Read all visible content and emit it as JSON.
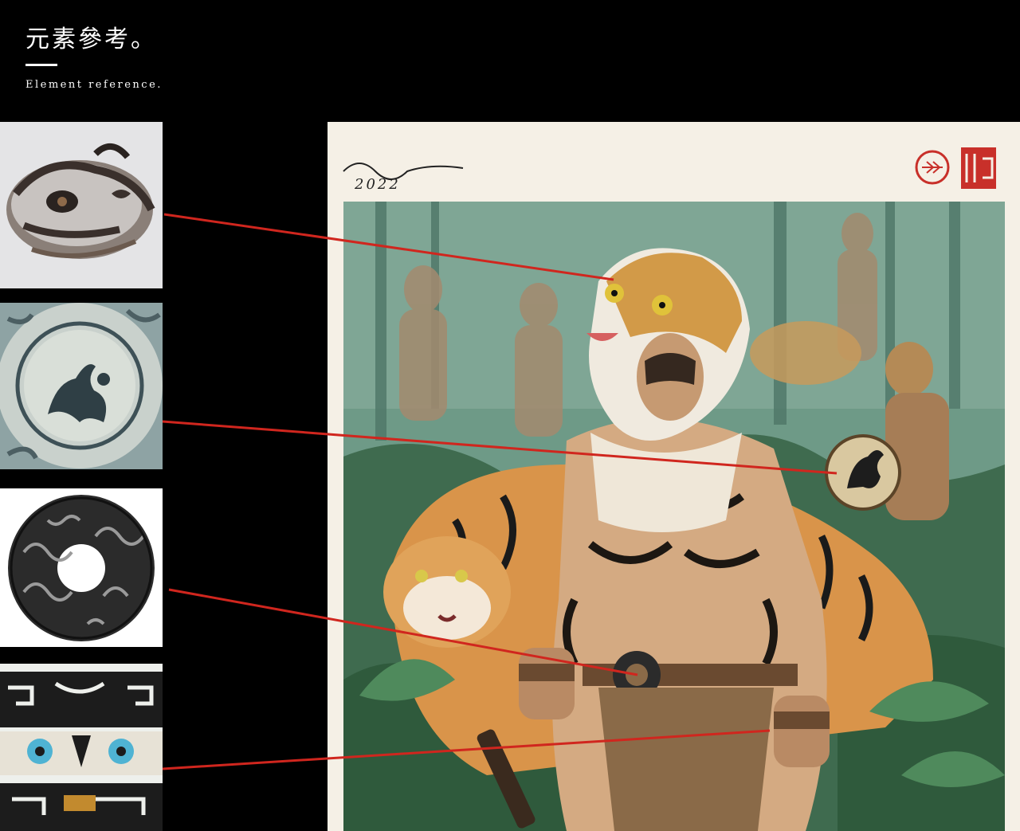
{
  "header": {
    "title_cn": "元素參考。",
    "title_en": "Element reference."
  },
  "painting": {
    "signature_year": "2022"
  },
  "references": [
    {
      "icon": "metal-tiger-mask"
    },
    {
      "icon": "tiger-disc-emblem"
    },
    {
      "icon": "jade-bi-disc"
    },
    {
      "icon": "taotie-pattern-band"
    }
  ],
  "colors": {
    "background": "#000000",
    "text": "#ffffff",
    "connector": "#d0261e",
    "paper": "#f5f0e6",
    "jungle": "#5c8f7a"
  }
}
